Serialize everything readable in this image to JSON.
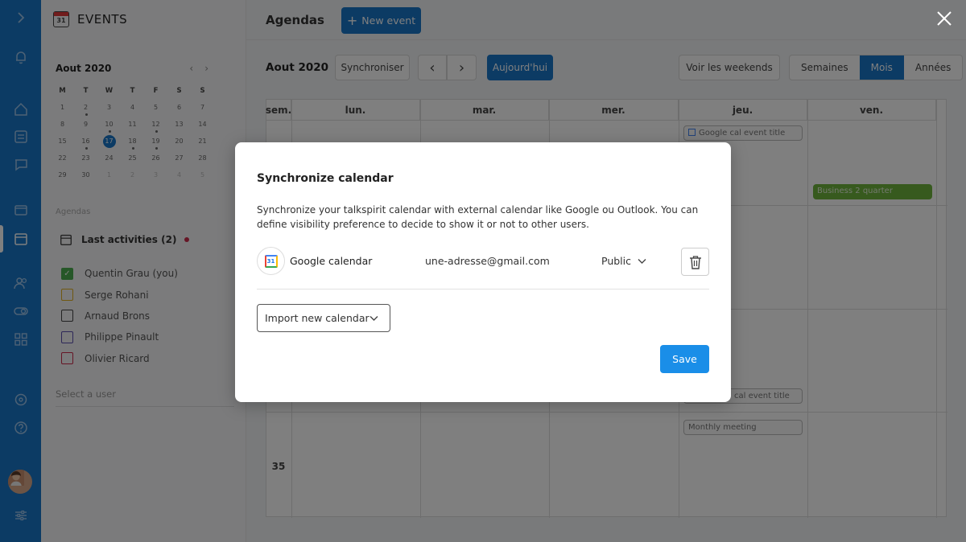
{
  "sidebar": {
    "title": "EVENTS",
    "calendar_icon_day": "31",
    "mini_calendar": {
      "month": "Aout 2020",
      "day_names": [
        "M",
        "T",
        "W",
        "T",
        "F",
        "S",
        "S"
      ],
      "weeks": [
        [
          "1",
          "2",
          "3",
          "4",
          "5",
          "6",
          "7"
        ],
        [
          "8",
          "9",
          "10",
          "11",
          "12",
          "13",
          "14"
        ],
        [
          "15",
          "16",
          "17",
          "18",
          "19",
          "20",
          "21"
        ],
        [
          "22",
          "23",
          "24",
          "25",
          "26",
          "27",
          "28"
        ],
        [
          "29",
          "30",
          "1",
          "2",
          "3",
          "4",
          "5"
        ]
      ],
      "today": "17"
    },
    "section_label": "Agendas",
    "last_activities": "Last activities (2)",
    "users": [
      {
        "name": "Quentin Grau (you)",
        "color": "#4caf50",
        "checked": true
      },
      {
        "name": "Serge Rohani",
        "color": "#e0b020",
        "checked": false
      },
      {
        "name": "Arnaud Brons",
        "color": "#444444",
        "checked": false
      },
      {
        "name": "Philippe Pinault",
        "color": "#5b4fb0",
        "checked": false
      },
      {
        "name": "Olivier Ricard",
        "color": "#cc2a4a",
        "checked": false
      }
    ],
    "search_placeholder": "Select a user"
  },
  "header": {
    "title": "Agendas",
    "new_event": "New event"
  },
  "toolbar": {
    "month": "Aout 2020",
    "sync": "Synchroniser",
    "prev": "‹",
    "next": "›",
    "today": "Aujourd'hui",
    "weekends": "Voir les weekends",
    "views": [
      "Semaines",
      "Mois",
      "Années"
    ],
    "active_view": "Mois"
  },
  "calendar": {
    "columns": [
      "sem.",
      "lun.",
      "mar.",
      "mer.",
      "jeu.",
      "ven."
    ],
    "week_number": "35",
    "events": [
      {
        "title": "Google cal event title",
        "style": "outline"
      },
      {
        "title": "Business 2 quarter",
        "style": "green"
      },
      {
        "title": "cal event title",
        "style": "outline"
      },
      {
        "title": "Monthly meeting",
        "style": "outline"
      }
    ]
  },
  "modal": {
    "title": "Synchronize calendar",
    "description": "Synchronize your talkspirit calendar with external calendar like Google ou Outlook. You can define visibility preference to decide to show it or not to other users.",
    "account": {
      "icon_day": "31",
      "name": "Google calendar",
      "email": "une-adresse@gmail.com",
      "visibility": "Public"
    },
    "import_label": "Import new calendar",
    "save_label": "Save"
  }
}
